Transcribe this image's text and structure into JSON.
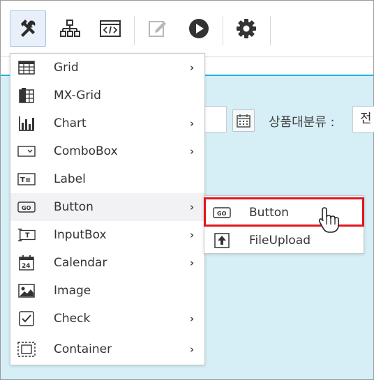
{
  "toolbar": {
    "buttons": [
      {
        "icon": "tools-icon",
        "active": true
      },
      {
        "icon": "hierarchy-icon",
        "active": false
      },
      {
        "icon": "code-view-icon",
        "active": false
      },
      {
        "icon": "edit-icon",
        "active": false
      },
      {
        "icon": "play-icon",
        "active": false
      },
      {
        "icon": "settings-icon",
        "active": false
      }
    ]
  },
  "canvas": {
    "category_label": "상품대분류 :",
    "category_value": "전"
  },
  "menu": {
    "items": [
      {
        "label": "Grid",
        "icon": "grid-icon",
        "has_submenu": true
      },
      {
        "label": "MX-Grid",
        "icon": "mx-grid-icon",
        "has_submenu": false
      },
      {
        "label": "Chart",
        "icon": "chart-icon",
        "has_submenu": true
      },
      {
        "label": "ComboBox",
        "icon": "combobox-icon",
        "has_submenu": true
      },
      {
        "label": "Label",
        "icon": "label-icon",
        "has_submenu": false
      },
      {
        "label": "Button",
        "icon": "button-icon",
        "has_submenu": true
      },
      {
        "label": "InputBox",
        "icon": "inputbox-icon",
        "has_submenu": true
      },
      {
        "label": "Calendar",
        "icon": "calendar-icon",
        "has_submenu": true
      },
      {
        "label": "Image",
        "icon": "image-icon",
        "has_submenu": false
      },
      {
        "label": "Check",
        "icon": "check-icon",
        "has_submenu": true
      },
      {
        "label": "Container",
        "icon": "container-icon",
        "has_submenu": true
      }
    ],
    "arrow": "›",
    "hovered": "Button"
  },
  "submenu": {
    "items": [
      {
        "label": "Button",
        "icon": "button-icon"
      },
      {
        "label": "FileUpload",
        "icon": "file-upload-icon"
      }
    ],
    "highlighted": "Button"
  },
  "colors": {
    "canvas_bg": "#d6eef6",
    "canvas_top_border": "#18b5e0",
    "highlight_border": "#e0161c",
    "active_button_bg": "#e9f0fa"
  }
}
